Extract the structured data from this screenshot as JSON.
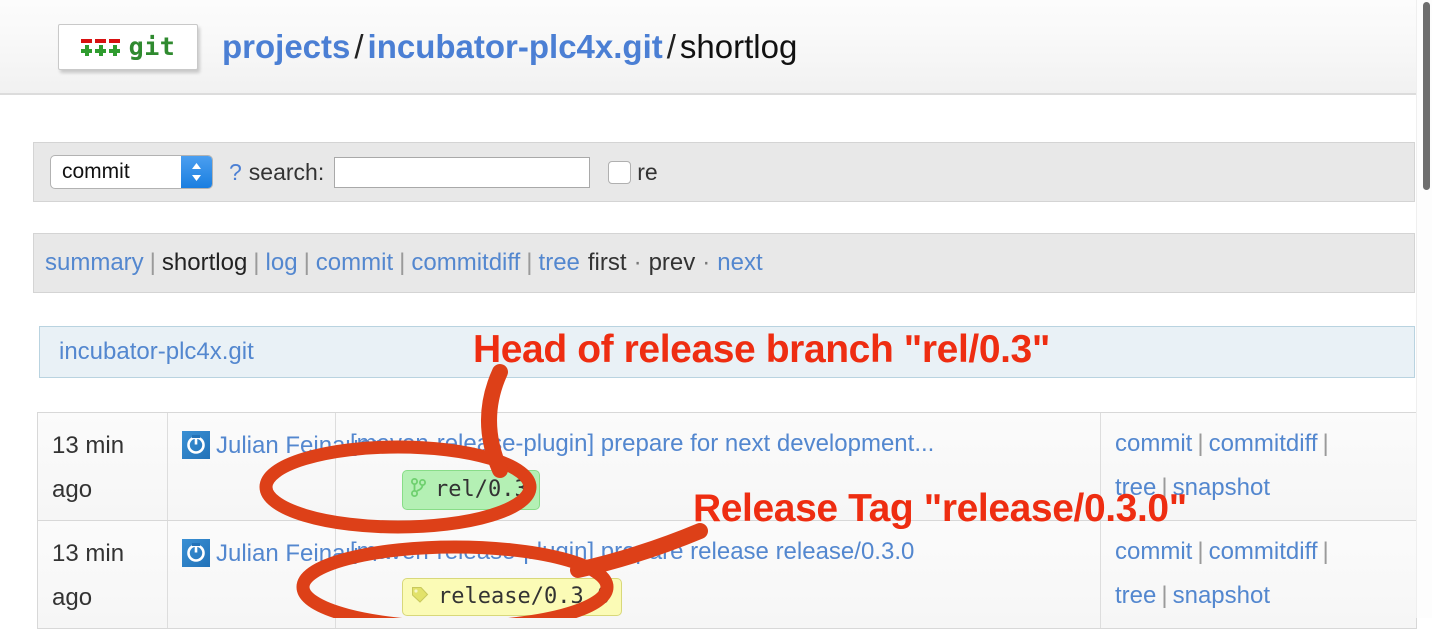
{
  "header": {
    "logo_alt": "git",
    "logo_text": "git",
    "projects_link": "projects",
    "sep1": "/",
    "repo_link": "incubator-plc4x.git",
    "sep2": "/",
    "page": "shortlog"
  },
  "search": {
    "scope_value": "commit",
    "help_label": "?",
    "label": "search:",
    "input_value": "",
    "input_placeholder": "",
    "checkbox_label": "re",
    "checkbox_checked": false
  },
  "nav": {
    "items": [
      {
        "label": "summary",
        "current": false
      },
      {
        "label": "shortlog",
        "current": true
      },
      {
        "label": "log",
        "current": false
      },
      {
        "label": "commit",
        "current": false
      },
      {
        "label": "commitdiff",
        "current": false
      },
      {
        "label": "tree",
        "current": false
      }
    ],
    "separator": "|",
    "pagination": {
      "first": "first",
      "dot": "·",
      "prev": "prev",
      "next": "next"
    }
  },
  "repo": {
    "title": "incubator-plc4x.git"
  },
  "shortlog": {
    "rows": [
      {
        "age": "13 min ago",
        "author": "Julian Feinauer",
        "avatar_icon": "gravatar-power-icon",
        "message": "[maven-release-plugin] prepare for next development...",
        "ref": {
          "type": "head",
          "icon": "branch-icon",
          "label": "rel/0.3"
        },
        "actions": [
          "commit",
          "commitdiff",
          "tree",
          "snapshot"
        ],
        "action_separator": "|"
      },
      {
        "age": "13 min ago",
        "author": "Julian Feinauer",
        "avatar_icon": "gravatar-power-icon",
        "message": "[maven-release-plugin] prepare release release/0.3.0",
        "ref": {
          "type": "tag",
          "icon": "tag-icon",
          "label": "release/0.3.0"
        },
        "actions": [
          "commit",
          "commitdiff",
          "tree",
          "snapshot"
        ],
        "action_separator": "|"
      }
    ]
  },
  "annotations": {
    "color": "#ee2d11",
    "items": [
      {
        "text": "Head of release branch \"rel/0.3\""
      },
      {
        "text": "Release Tag \"release/0.3.0\""
      }
    ]
  }
}
